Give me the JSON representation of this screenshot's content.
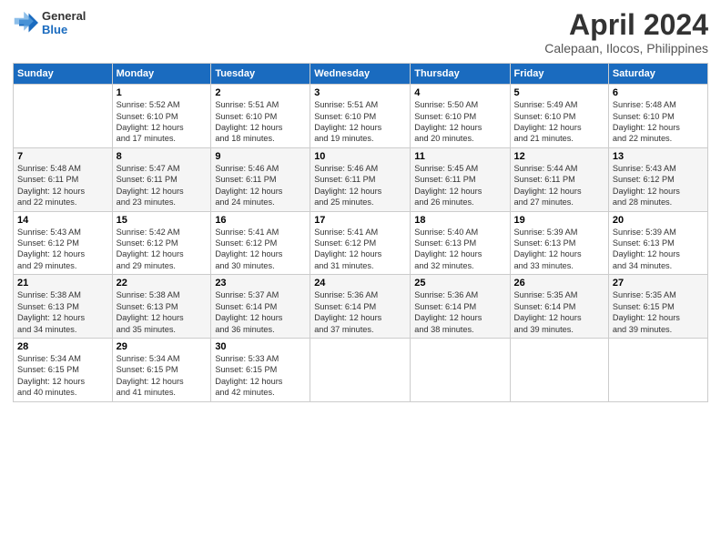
{
  "logo": {
    "general": "General",
    "blue": "Blue"
  },
  "title": "April 2024",
  "location": "Calepaan, Ilocos, Philippines",
  "days_header": [
    "Sunday",
    "Monday",
    "Tuesday",
    "Wednesday",
    "Thursday",
    "Friday",
    "Saturday"
  ],
  "weeks": [
    [
      {
        "day": "",
        "info": ""
      },
      {
        "day": "1",
        "info": "Sunrise: 5:52 AM\nSunset: 6:10 PM\nDaylight: 12 hours\nand 17 minutes."
      },
      {
        "day": "2",
        "info": "Sunrise: 5:51 AM\nSunset: 6:10 PM\nDaylight: 12 hours\nand 18 minutes."
      },
      {
        "day": "3",
        "info": "Sunrise: 5:51 AM\nSunset: 6:10 PM\nDaylight: 12 hours\nand 19 minutes."
      },
      {
        "day": "4",
        "info": "Sunrise: 5:50 AM\nSunset: 6:10 PM\nDaylight: 12 hours\nand 20 minutes."
      },
      {
        "day": "5",
        "info": "Sunrise: 5:49 AM\nSunset: 6:10 PM\nDaylight: 12 hours\nand 21 minutes."
      },
      {
        "day": "6",
        "info": "Sunrise: 5:48 AM\nSunset: 6:10 PM\nDaylight: 12 hours\nand 22 minutes."
      }
    ],
    [
      {
        "day": "7",
        "info": "Sunrise: 5:48 AM\nSunset: 6:11 PM\nDaylight: 12 hours\nand 22 minutes."
      },
      {
        "day": "8",
        "info": "Sunrise: 5:47 AM\nSunset: 6:11 PM\nDaylight: 12 hours\nand 23 minutes."
      },
      {
        "day": "9",
        "info": "Sunrise: 5:46 AM\nSunset: 6:11 PM\nDaylight: 12 hours\nand 24 minutes."
      },
      {
        "day": "10",
        "info": "Sunrise: 5:46 AM\nSunset: 6:11 PM\nDaylight: 12 hours\nand 25 minutes."
      },
      {
        "day": "11",
        "info": "Sunrise: 5:45 AM\nSunset: 6:11 PM\nDaylight: 12 hours\nand 26 minutes."
      },
      {
        "day": "12",
        "info": "Sunrise: 5:44 AM\nSunset: 6:11 PM\nDaylight: 12 hours\nand 27 minutes."
      },
      {
        "day": "13",
        "info": "Sunrise: 5:43 AM\nSunset: 6:12 PM\nDaylight: 12 hours\nand 28 minutes."
      }
    ],
    [
      {
        "day": "14",
        "info": "Sunrise: 5:43 AM\nSunset: 6:12 PM\nDaylight: 12 hours\nand 29 minutes."
      },
      {
        "day": "15",
        "info": "Sunrise: 5:42 AM\nSunset: 6:12 PM\nDaylight: 12 hours\nand 29 minutes."
      },
      {
        "day": "16",
        "info": "Sunrise: 5:41 AM\nSunset: 6:12 PM\nDaylight: 12 hours\nand 30 minutes."
      },
      {
        "day": "17",
        "info": "Sunrise: 5:41 AM\nSunset: 6:12 PM\nDaylight: 12 hours\nand 31 minutes."
      },
      {
        "day": "18",
        "info": "Sunrise: 5:40 AM\nSunset: 6:13 PM\nDaylight: 12 hours\nand 32 minutes."
      },
      {
        "day": "19",
        "info": "Sunrise: 5:39 AM\nSunset: 6:13 PM\nDaylight: 12 hours\nand 33 minutes."
      },
      {
        "day": "20",
        "info": "Sunrise: 5:39 AM\nSunset: 6:13 PM\nDaylight: 12 hours\nand 34 minutes."
      }
    ],
    [
      {
        "day": "21",
        "info": "Sunrise: 5:38 AM\nSunset: 6:13 PM\nDaylight: 12 hours\nand 34 minutes."
      },
      {
        "day": "22",
        "info": "Sunrise: 5:38 AM\nSunset: 6:13 PM\nDaylight: 12 hours\nand 35 minutes."
      },
      {
        "day": "23",
        "info": "Sunrise: 5:37 AM\nSunset: 6:14 PM\nDaylight: 12 hours\nand 36 minutes."
      },
      {
        "day": "24",
        "info": "Sunrise: 5:36 AM\nSunset: 6:14 PM\nDaylight: 12 hours\nand 37 minutes."
      },
      {
        "day": "25",
        "info": "Sunrise: 5:36 AM\nSunset: 6:14 PM\nDaylight: 12 hours\nand 38 minutes."
      },
      {
        "day": "26",
        "info": "Sunrise: 5:35 AM\nSunset: 6:14 PM\nDaylight: 12 hours\nand 39 minutes."
      },
      {
        "day": "27",
        "info": "Sunrise: 5:35 AM\nSunset: 6:15 PM\nDaylight: 12 hours\nand 39 minutes."
      }
    ],
    [
      {
        "day": "28",
        "info": "Sunrise: 5:34 AM\nSunset: 6:15 PM\nDaylight: 12 hours\nand 40 minutes."
      },
      {
        "day": "29",
        "info": "Sunrise: 5:34 AM\nSunset: 6:15 PM\nDaylight: 12 hours\nand 41 minutes."
      },
      {
        "day": "30",
        "info": "Sunrise: 5:33 AM\nSunset: 6:15 PM\nDaylight: 12 hours\nand 42 minutes."
      },
      {
        "day": "",
        "info": ""
      },
      {
        "day": "",
        "info": ""
      },
      {
        "day": "",
        "info": ""
      },
      {
        "day": "",
        "info": ""
      }
    ]
  ]
}
